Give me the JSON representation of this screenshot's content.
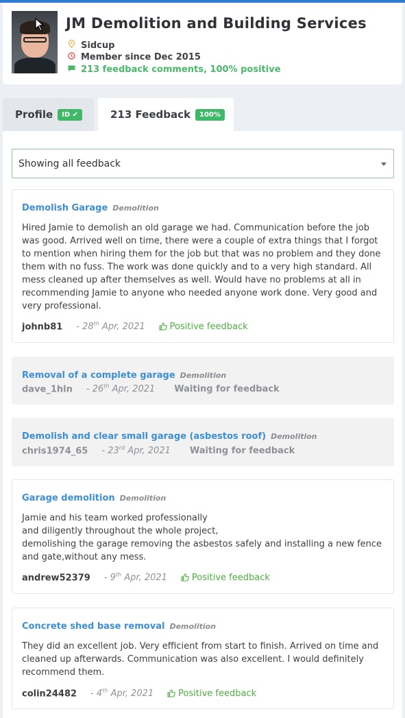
{
  "header": {
    "title": "JM Demolition and Building Services",
    "location": "Sidcup",
    "member_since": "Member since Dec 2015",
    "feedback_summary": "213 feedback comments, 100% positive"
  },
  "tabs": [
    {
      "label": "Profile",
      "badge": "ID ✔"
    },
    {
      "label": "213 Feedback",
      "badge": "100%"
    }
  ],
  "filter": {
    "selected": "Showing all feedback"
  },
  "feedback": [
    {
      "title": "Demolish Garage",
      "category": "Demolition",
      "text": "Hired Jamie to demolish an old garage we had. Communication before the job was good. Arrived well on time, there were a couple of extra things that I forgot to mention when hiring them for the job but that was no problem and they done them with no fuss. The work was done quickly and to a very high standard. All mess cleaned up after themselves as well. Would have no problems at all in recommending Jamie to anyone who needed anyone work done. Very good and very professional.",
      "user": "johnb81",
      "date_prefix": "- 28",
      "date_suffix": "th",
      "date_rest": " Apr, 2021",
      "status": "Positive feedback"
    },
    {
      "title": "Removal of a complete garage",
      "category": "Demolition",
      "user": "dave_1hln",
      "date_prefix": "- 26",
      "date_suffix": "th",
      "date_rest": " Apr, 2021",
      "status": "Waiting for feedback"
    },
    {
      "title": "Demolish and clear small garage (asbestos roof)",
      "category": "Demolition",
      "user": "chris1974_65",
      "date_prefix": "- 23",
      "date_suffix": "rd",
      "date_rest": " Apr, 2021",
      "status": "Waiting for feedback"
    },
    {
      "title": "Garage demolition",
      "category": "Demolition",
      "text_lines": [
        "Jamie and his team worked professionally",
        "and diligently throughout the whole project,",
        "demolishing the garage removing the asbestos safely and installing a new fence and gate,without any mess."
      ],
      "user": "andrew52379",
      "date_prefix": "- 9",
      "date_suffix": "th",
      "date_rest": " Apr, 2021",
      "status": "Positive feedback"
    },
    {
      "title": "Concrete shed base removal",
      "category": "Demolition",
      "text": "They did an excellent job. Very efficient from start to finish. Arrived on time and cleaned up afterwards. Communication was also excellent. I would definitely recommend them.",
      "user": "colin24482",
      "date_prefix": "- 4",
      "date_suffix": "th",
      "date_rest": " Apr, 2021",
      "status": "Positive feedback"
    }
  ],
  "colors": {
    "accent_blue": "#3d8ed4",
    "positive_green": "#4caf3f",
    "badge_green": "#3fb868"
  }
}
